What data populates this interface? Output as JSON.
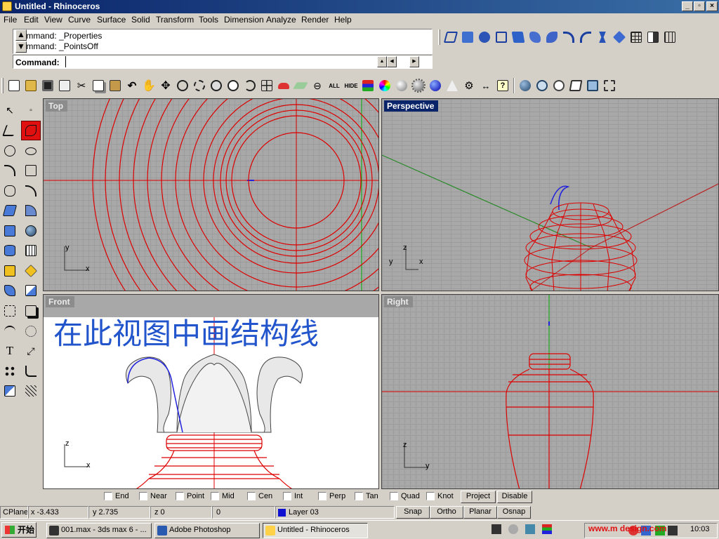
{
  "window": {
    "title": "Untitled - Rhinoceros",
    "min_label": "_",
    "max_label": "▫",
    "close_label": "×"
  },
  "menu": [
    "File",
    "Edit",
    "View",
    "Curve",
    "Surface",
    "Solid",
    "Transform",
    "Tools",
    "Dimension",
    "Analyze",
    "Render",
    "Help"
  ],
  "command": {
    "history": [
      "Command: _Properties",
      "Command: _PointsOff"
    ],
    "label": "Command:",
    "value": ""
  },
  "toolbar": {
    "all_label": "ALL",
    "hide_label": "HIDE"
  },
  "viewports": {
    "top": {
      "label": "Top"
    },
    "perspective": {
      "label": "Perspective"
    },
    "front": {
      "label": "Front",
      "annotation": "在此视图中画结构线"
    },
    "right": {
      "label": "Right"
    }
  },
  "axes": {
    "x": "x",
    "y": "y",
    "z": "z"
  },
  "osnap": {
    "options": [
      "End",
      "Near",
      "Point",
      "Mid",
      "Cen",
      "Int",
      "Perp",
      "Tan",
      "Quad",
      "Knot"
    ],
    "project_label": "Project",
    "disable_label": "Disable"
  },
  "status": {
    "cplane": "CPlane",
    "x": "x -3.433",
    "y": "y 2.735",
    "z": "z 0",
    "extra": "0",
    "layer": "Layer 03",
    "layer_color": "#1010d0",
    "snap": "Snap",
    "ortho": "Ortho",
    "planar": "Planar",
    "osnap": "Osnap"
  },
  "taskbar": {
    "start": "开始",
    "tasks": [
      "001.max - 3ds max 6 - ...",
      "Adobe Photoshop",
      "Untitled - Rhinoceros"
    ],
    "watermark": "www.m    design.com",
    "time": "10:03"
  }
}
